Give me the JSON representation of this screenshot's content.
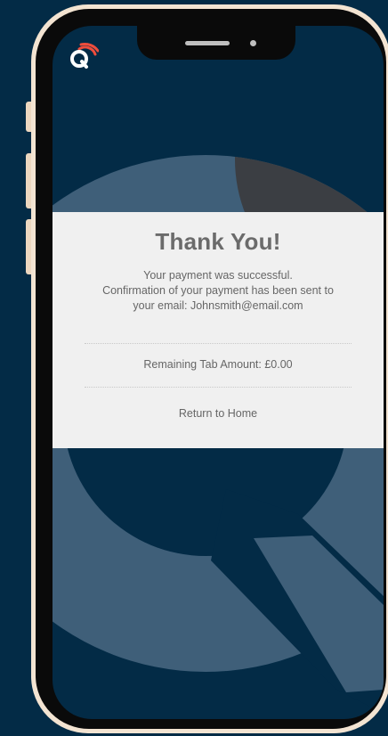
{
  "app": {
    "logo_icon": "q-wifi-logo-icon",
    "brand_color": "#ef4d3c",
    "background_color": "#032b46"
  },
  "confirmation": {
    "title": "Thank You!",
    "message_lines": [
      "Your payment was successful.",
      "Confirmation of your payment has been sent to",
      "your email: Johnsmith@email.com"
    ],
    "remaining_tab": "Remaining Tab Amount: £0.00",
    "return_link": "Return to Home"
  }
}
